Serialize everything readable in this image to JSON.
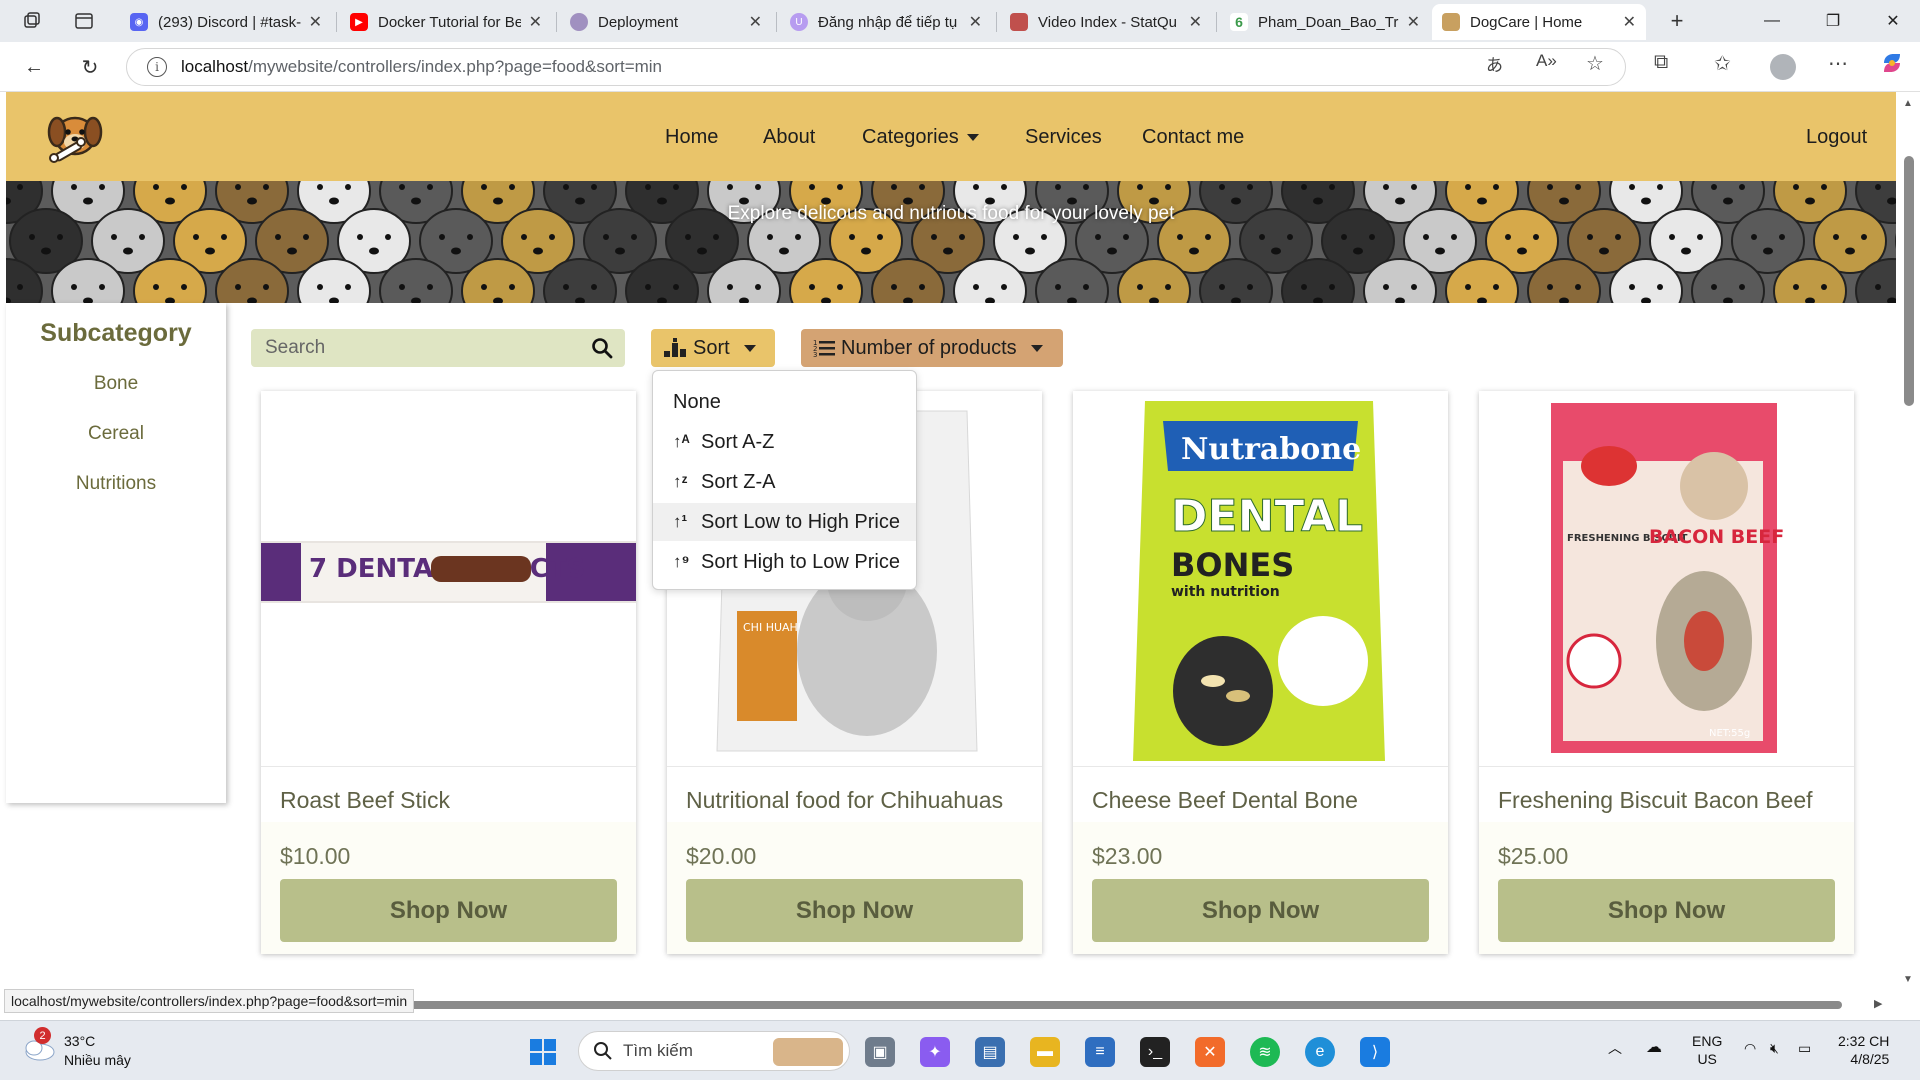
{
  "browser": {
    "tabs": [
      {
        "label": "(293) Discord | #task-",
        "badge": "293",
        "color": "#5865f2"
      },
      {
        "label": "Docker Tutorial for Be",
        "color": "#ff0000"
      },
      {
        "label": "Deployment",
        "color": "#a090c0"
      },
      {
        "label": "Đăng nhập để tiếp tụ",
        "color": "#b79cf0"
      },
      {
        "label": "Video Index - StatQu",
        "color": "#c0504d"
      },
      {
        "label": "Pham_Doan_Bao_Trur",
        "color": "#3c9a4b"
      },
      {
        "label": "DogCare | Home",
        "color": "#c8a060",
        "active": true
      }
    ],
    "url_host": "localhost",
    "url_path": "/mywebsite/controllers/index.php?page=food&sort=min",
    "status_url": "localhost/mywebsite/controllers/index.php?page=food&sort=min"
  },
  "site": {
    "nav": {
      "home": "Home",
      "about": "About",
      "categories": "Categories",
      "services": "Services",
      "contact": "Contact me",
      "logout": "Logout"
    },
    "banner_text": "Explore delicous and nutrious food for your lovely pet",
    "sidebar": {
      "title": "Subcategory",
      "items": [
        "Bone",
        "Cereal",
        "Nutritions"
      ]
    },
    "toolbar": {
      "search_placeholder": "Search",
      "sort_label": "Sort",
      "number_label": "Number of products"
    },
    "sort_menu": [
      {
        "label": "None",
        "icon": ""
      },
      {
        "label": "Sort A-Z",
        "icon": "sort-alpha-asc-icon"
      },
      {
        "label": "Sort Z-A",
        "icon": "sort-alpha-desc-icon"
      },
      {
        "label": "Sort Low to High Price",
        "icon": "sort-numeric-asc-icon"
      },
      {
        "label": "Sort High to Low Price",
        "icon": "sort-numeric-desc-icon"
      }
    ],
    "products": [
      {
        "name": "Roast Beef Stick",
        "price": "$10.00",
        "button": "Shop Now",
        "img_text": "7 DENTAL EFFECTS"
      },
      {
        "name": "Nutritional food for Chihuahuas",
        "price": "$20.00",
        "button": "Shop Now",
        "img_text": "CHI HUAHUA NUTRITION"
      },
      {
        "name": "Cheese Beef Dental Bone",
        "price": "$23.00",
        "button": "Shop Now",
        "img_text_1": "Nutrabone",
        "img_text_2": "DENTAL",
        "img_text_3": "BONES",
        "img_text_4": "with nutrition"
      },
      {
        "name": "Freshening Biscuit Bacon Beef",
        "price": "$25.00",
        "button": "Shop Now",
        "img_text_1": "FRESHENING BISCUIT",
        "img_text_2": "BACON BEEF",
        "img_text_3": "NET:55g"
      }
    ],
    "colors": {
      "header": "#e9c46a",
      "sort_button": "#e9c46a",
      "number_button": "#d4a373",
      "shop_button": "#b8bf8a",
      "search_bg": "#dfe5c3"
    }
  },
  "taskbar": {
    "weather_temp": "33°C",
    "weather_desc": "Nhiều mây",
    "weather_badge": "2",
    "search_placeholder": "Tìm kiếm",
    "lang_1": "ENG",
    "lang_2": "US",
    "time": "2:32 CH",
    "date": "4/8/25"
  }
}
